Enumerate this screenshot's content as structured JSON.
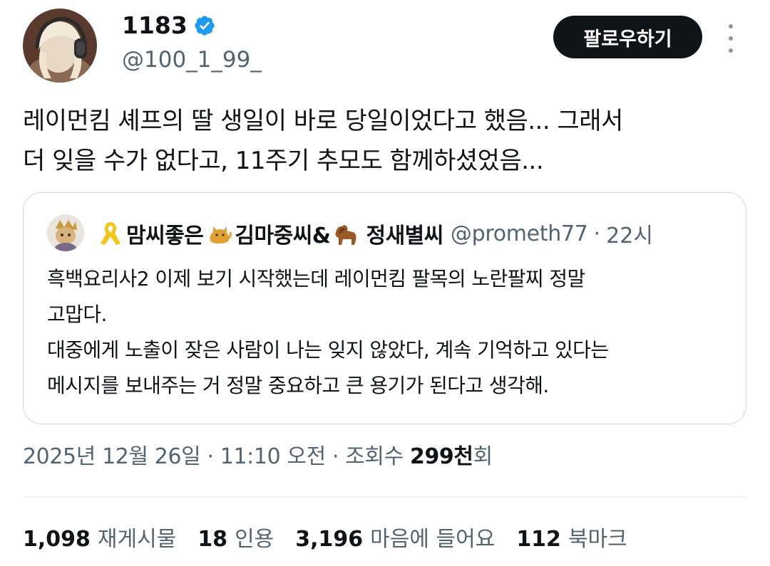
{
  "author": {
    "name": "1183",
    "handle": "@100_1_99_",
    "verified": true,
    "verified_color": "#1d9bf0"
  },
  "actions": {
    "follow_label": "팔로우하기",
    "more_icon": "more-vertical-icon"
  },
  "tweet": {
    "text_line1": "레이먼킴 셰프의 딸 생일이 바로 당일이었다고 했음... 그래서",
    "text_line2": "더 잊을 수가 없다고, 11주기 추모도 함께하셨었음..."
  },
  "quote": {
    "ribbon_icon": "yellow-ribbon-icon",
    "name_part1": "맘씨좋은",
    "cat_icon": "cat-emoji-icon",
    "name_part2": "김마중씨&",
    "dog_icon": "dog-emoji-icon",
    "name_part3": "정새별씨",
    "handle": "@prometh77",
    "separator": "·",
    "time": "22시",
    "text_line1": "흑백요리사2 이제 보기 시작했는데 레이먼킴 팔목의 노란팔찌 정말",
    "text_line2": "고맙다.",
    "text_line3": "대중에게 노출이 잦은 사람이 나는 잊지 않았다, 계속 기억하고 있다는",
    "text_line4": "메시지를 보내주는 거 정말 중요하고 큰 용기가 된다고 생각해."
  },
  "meta": {
    "date": "2025년 12월 26일",
    "sep1": "·",
    "time": "11:10 오전",
    "sep2": "·",
    "views_label": "조회수",
    "views_num": "299천",
    "views_suffix": "회"
  },
  "stats": {
    "retweets_num": "1,098",
    "retweets_label": "재게시물",
    "quotes_num": "18",
    "quotes_label": "인용",
    "likes_num": "3,196",
    "likes_label": "마음에 들어요",
    "bookmarks_num": "112",
    "bookmarks_label": "북마크"
  },
  "colors": {
    "text_primary": "#0f1419",
    "text_secondary": "#536471",
    "border": "#cfd9de",
    "button_bg": "#0f1419"
  }
}
